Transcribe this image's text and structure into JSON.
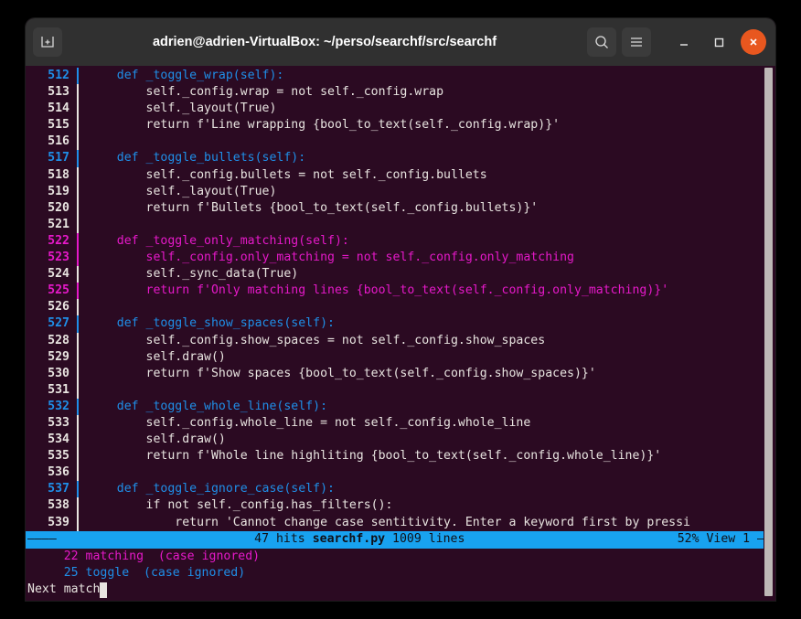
{
  "window": {
    "title": "adrien@adrien-VirtualBox: ~/perso/searchf/src/searchf",
    "new_tab_label": "new-tab",
    "search_label": "Search",
    "menu_label": "Menu",
    "minimize_label": "Minimize",
    "maximize_label": "Maximize",
    "close_label": "Close"
  },
  "colors": {
    "background": "#2b0a22",
    "titlebar": "#303030",
    "close": "#e8571f",
    "status_bar": "#18a2f0",
    "text_white": "#e8e4e0",
    "text_cyan": "#1f8fe8",
    "text_magenta": "#e619c9",
    "scrollbar": "#bdb8b6"
  },
  "editor": {
    "lines": [
      {
        "no": "512",
        "color": "cyan",
        "text": "    def _toggle_wrap(self):"
      },
      {
        "no": "513",
        "color": "white",
        "text": "        self._config.wrap = not self._config.wrap"
      },
      {
        "no": "514",
        "color": "white",
        "text": "        self._layout(True)"
      },
      {
        "no": "515",
        "color": "white",
        "text": "        return f'Line wrapping {bool_to_text(self._config.wrap)}'"
      },
      {
        "no": "516",
        "color": "white",
        "text": ""
      },
      {
        "no": "517",
        "color": "cyan",
        "text": "    def _toggle_bullets(self):"
      },
      {
        "no": "518",
        "color": "white",
        "text": "        self._config.bullets = not self._config.bullets"
      },
      {
        "no": "519",
        "color": "white",
        "text": "        self._layout(True)"
      },
      {
        "no": "520",
        "color": "white",
        "text": "        return f'Bullets {bool_to_text(self._config.bullets)}'"
      },
      {
        "no": "521",
        "color": "white",
        "text": ""
      },
      {
        "no": "522",
        "color": "magenta",
        "text": "    def _toggle_only_matching(self):"
      },
      {
        "no": "523",
        "color": "magenta",
        "text": "        self._config.only_matching = not self._config.only_matching"
      },
      {
        "no": "524",
        "color": "white",
        "text": "        self._sync_data(True)"
      },
      {
        "no": "525",
        "color": "magenta",
        "text": "        return f'Only matching lines {bool_to_text(self._config.only_matching)}'"
      },
      {
        "no": "526",
        "color": "white",
        "text": ""
      },
      {
        "no": "527",
        "color": "cyan",
        "text": "    def _toggle_show_spaces(self):"
      },
      {
        "no": "528",
        "color": "white",
        "text": "        self._config.show_spaces = not self._config.show_spaces"
      },
      {
        "no": "529",
        "color": "white",
        "text": "        self.draw()"
      },
      {
        "no": "530",
        "color": "white",
        "text": "        return f'Show spaces {bool_to_text(self._config.show_spaces)}'"
      },
      {
        "no": "531",
        "color": "white",
        "text": ""
      },
      {
        "no": "532",
        "color": "cyan",
        "text": "    def _toggle_whole_line(self):"
      },
      {
        "no": "533",
        "color": "white",
        "text": "        self._config.whole_line = not self._config.whole_line"
      },
      {
        "no": "534",
        "color": "white",
        "text": "        self.draw()"
      },
      {
        "no": "535",
        "color": "white",
        "text": "        return f'Whole line highliting {bool_to_text(self._config.whole_line)}'"
      },
      {
        "no": "536",
        "color": "white",
        "text": ""
      },
      {
        "no": "537",
        "color": "cyan",
        "text": "    def _toggle_ignore_case(self):"
      },
      {
        "no": "538",
        "color": "white",
        "text": "        if not self._config.has_filters():"
      },
      {
        "no": "539",
        "color": "white",
        "text": "            return 'Cannot change case sentitivity. Enter a keyword first by pressi"
      }
    ]
  },
  "status": {
    "dash_left": "————",
    "hits": "47 hits ",
    "filename": "searchf.py",
    "lines": " 1009 lines ",
    "percent_view": " 52% View 1 ",
    "dash_right": "—"
  },
  "filters": [
    {
      "count": "     22 matching",
      "mode": "  (case ignored)",
      "color": "magenta"
    },
    {
      "count": "     25 toggle",
      "mode": "  (case ignored)",
      "color": "cyan"
    }
  ],
  "prompt": {
    "text": "Next match"
  }
}
